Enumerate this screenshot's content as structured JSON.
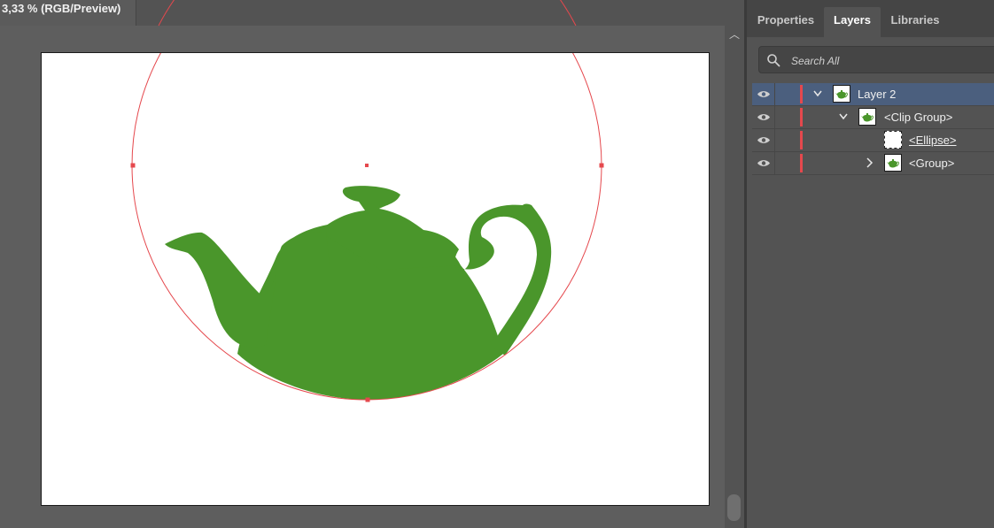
{
  "document": {
    "tab_title": "3,33 % (RGB/Preview)"
  },
  "panel": {
    "tabs": [
      {
        "label": "Properties",
        "active": false
      },
      {
        "label": "Layers",
        "active": true
      },
      {
        "label": "Libraries",
        "active": false
      }
    ],
    "search": {
      "placeholder": "Search All",
      "value": ""
    }
  },
  "layers": [
    {
      "name": "Layer 2",
      "expanded": true,
      "selected": true,
      "visible": true,
      "thumbnail": "teapot"
    },
    {
      "name": "<Clip Group>",
      "expanded": true,
      "selected": false,
      "visible": true,
      "thumbnail": "teapot"
    },
    {
      "name": "<Ellipse>",
      "selected": false,
      "visible": true,
      "thumbnail": "empty",
      "underlined": true
    },
    {
      "name": "<Group>",
      "expanded": false,
      "selected": false,
      "visible": true,
      "thumbnail": "teapot"
    }
  ],
  "colors": {
    "teapot_fill": "#4a962b",
    "selection": "#e5484d",
    "layer_color": "#e5484d",
    "selected_row": "#4b5f7e"
  }
}
